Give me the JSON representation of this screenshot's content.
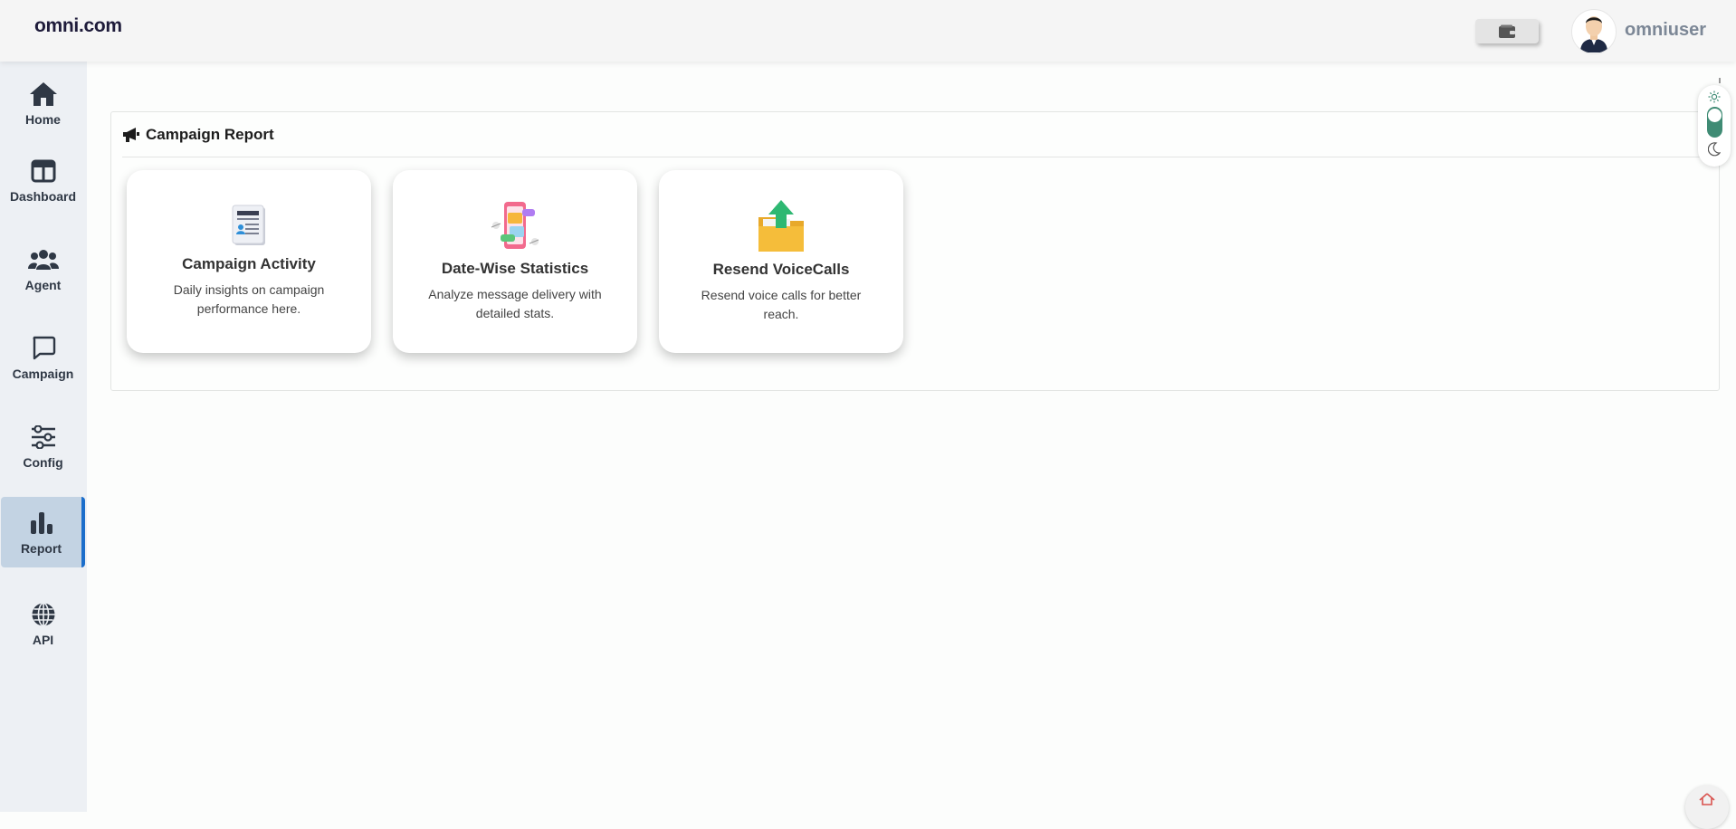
{
  "header": {
    "logo": "omni.com",
    "username": "omniuser"
  },
  "sidebar": {
    "items": [
      {
        "label": "Home",
        "icon": "home-icon"
      },
      {
        "label": "Dashboard",
        "icon": "dashboard-icon"
      },
      {
        "label": "Agent",
        "icon": "users-icon"
      },
      {
        "label": "Campaign",
        "icon": "chat-bubble-icon"
      },
      {
        "label": "Config",
        "icon": "sliders-icon"
      },
      {
        "label": "Report",
        "icon": "bar-chart-icon",
        "active": true
      },
      {
        "label": "API",
        "icon": "globe-icon"
      }
    ]
  },
  "main": {
    "panel_title": "Campaign Report",
    "cards": [
      {
        "title": "Campaign Activity",
        "description": "Daily insights on campaign performance here.",
        "icon": "document-icon"
      },
      {
        "title": "Date-Wise Statistics",
        "description": "Analyze message delivery with detailed stats.",
        "icon": "phone-stats-icon"
      },
      {
        "title": "Resend VoiceCalls",
        "description": "Resend voice calls for better reach.",
        "icon": "folder-upload-icon"
      }
    ]
  },
  "colors": {
    "accent": "#1b6ecb",
    "active_bg": "#c3d3e3",
    "toggle": "#3f8b74"
  }
}
